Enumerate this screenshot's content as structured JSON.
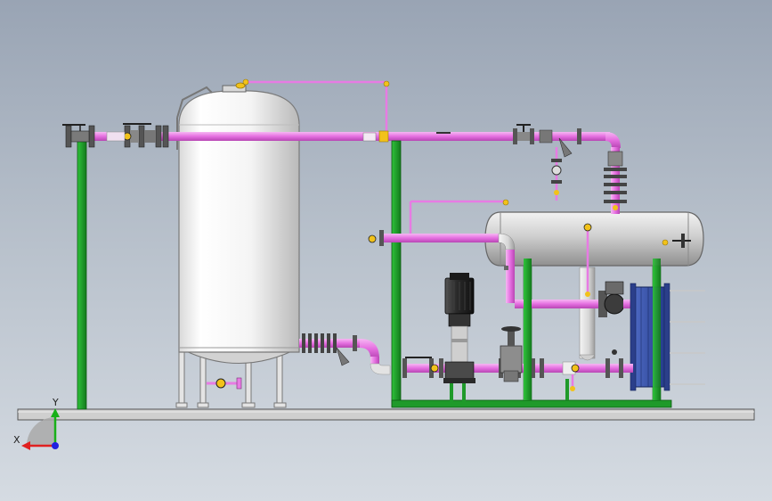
{
  "triad": {
    "x_label": "X",
    "y_label": "Y",
    "x_color": "#e02020",
    "y_color": "#18b018",
    "z_color": "#2020e0"
  },
  "colors": {
    "background_top": "#99a4b4",
    "background_bottom": "#d5dbe2",
    "process_pipe": "#e77be3",
    "steel_frame": "#1f9a2a",
    "vessel_body": "#f4f4f4",
    "flash_tank": "#c8c8c8",
    "valve_handle": "#f2c21a",
    "base_plate": "#c9c9c9",
    "plate_exchanger": "#3a52a8",
    "pump_motor": "#2b2b2b"
  },
  "components": [
    {
      "name": "vertical-storage-tank",
      "icon": "vertical-vessel-icon"
    },
    {
      "name": "horizontal-flash-tank",
      "icon": "horizontal-vessel-icon"
    },
    {
      "name": "plate-heat-exchanger",
      "icon": "plate-exchanger-icon"
    },
    {
      "name": "vertical-multistage-pump",
      "icon": "pump-icon"
    },
    {
      "name": "steel-frame",
      "icon": "frame-icon"
    },
    {
      "name": "base-plate",
      "icon": "plate-icon"
    }
  ]
}
